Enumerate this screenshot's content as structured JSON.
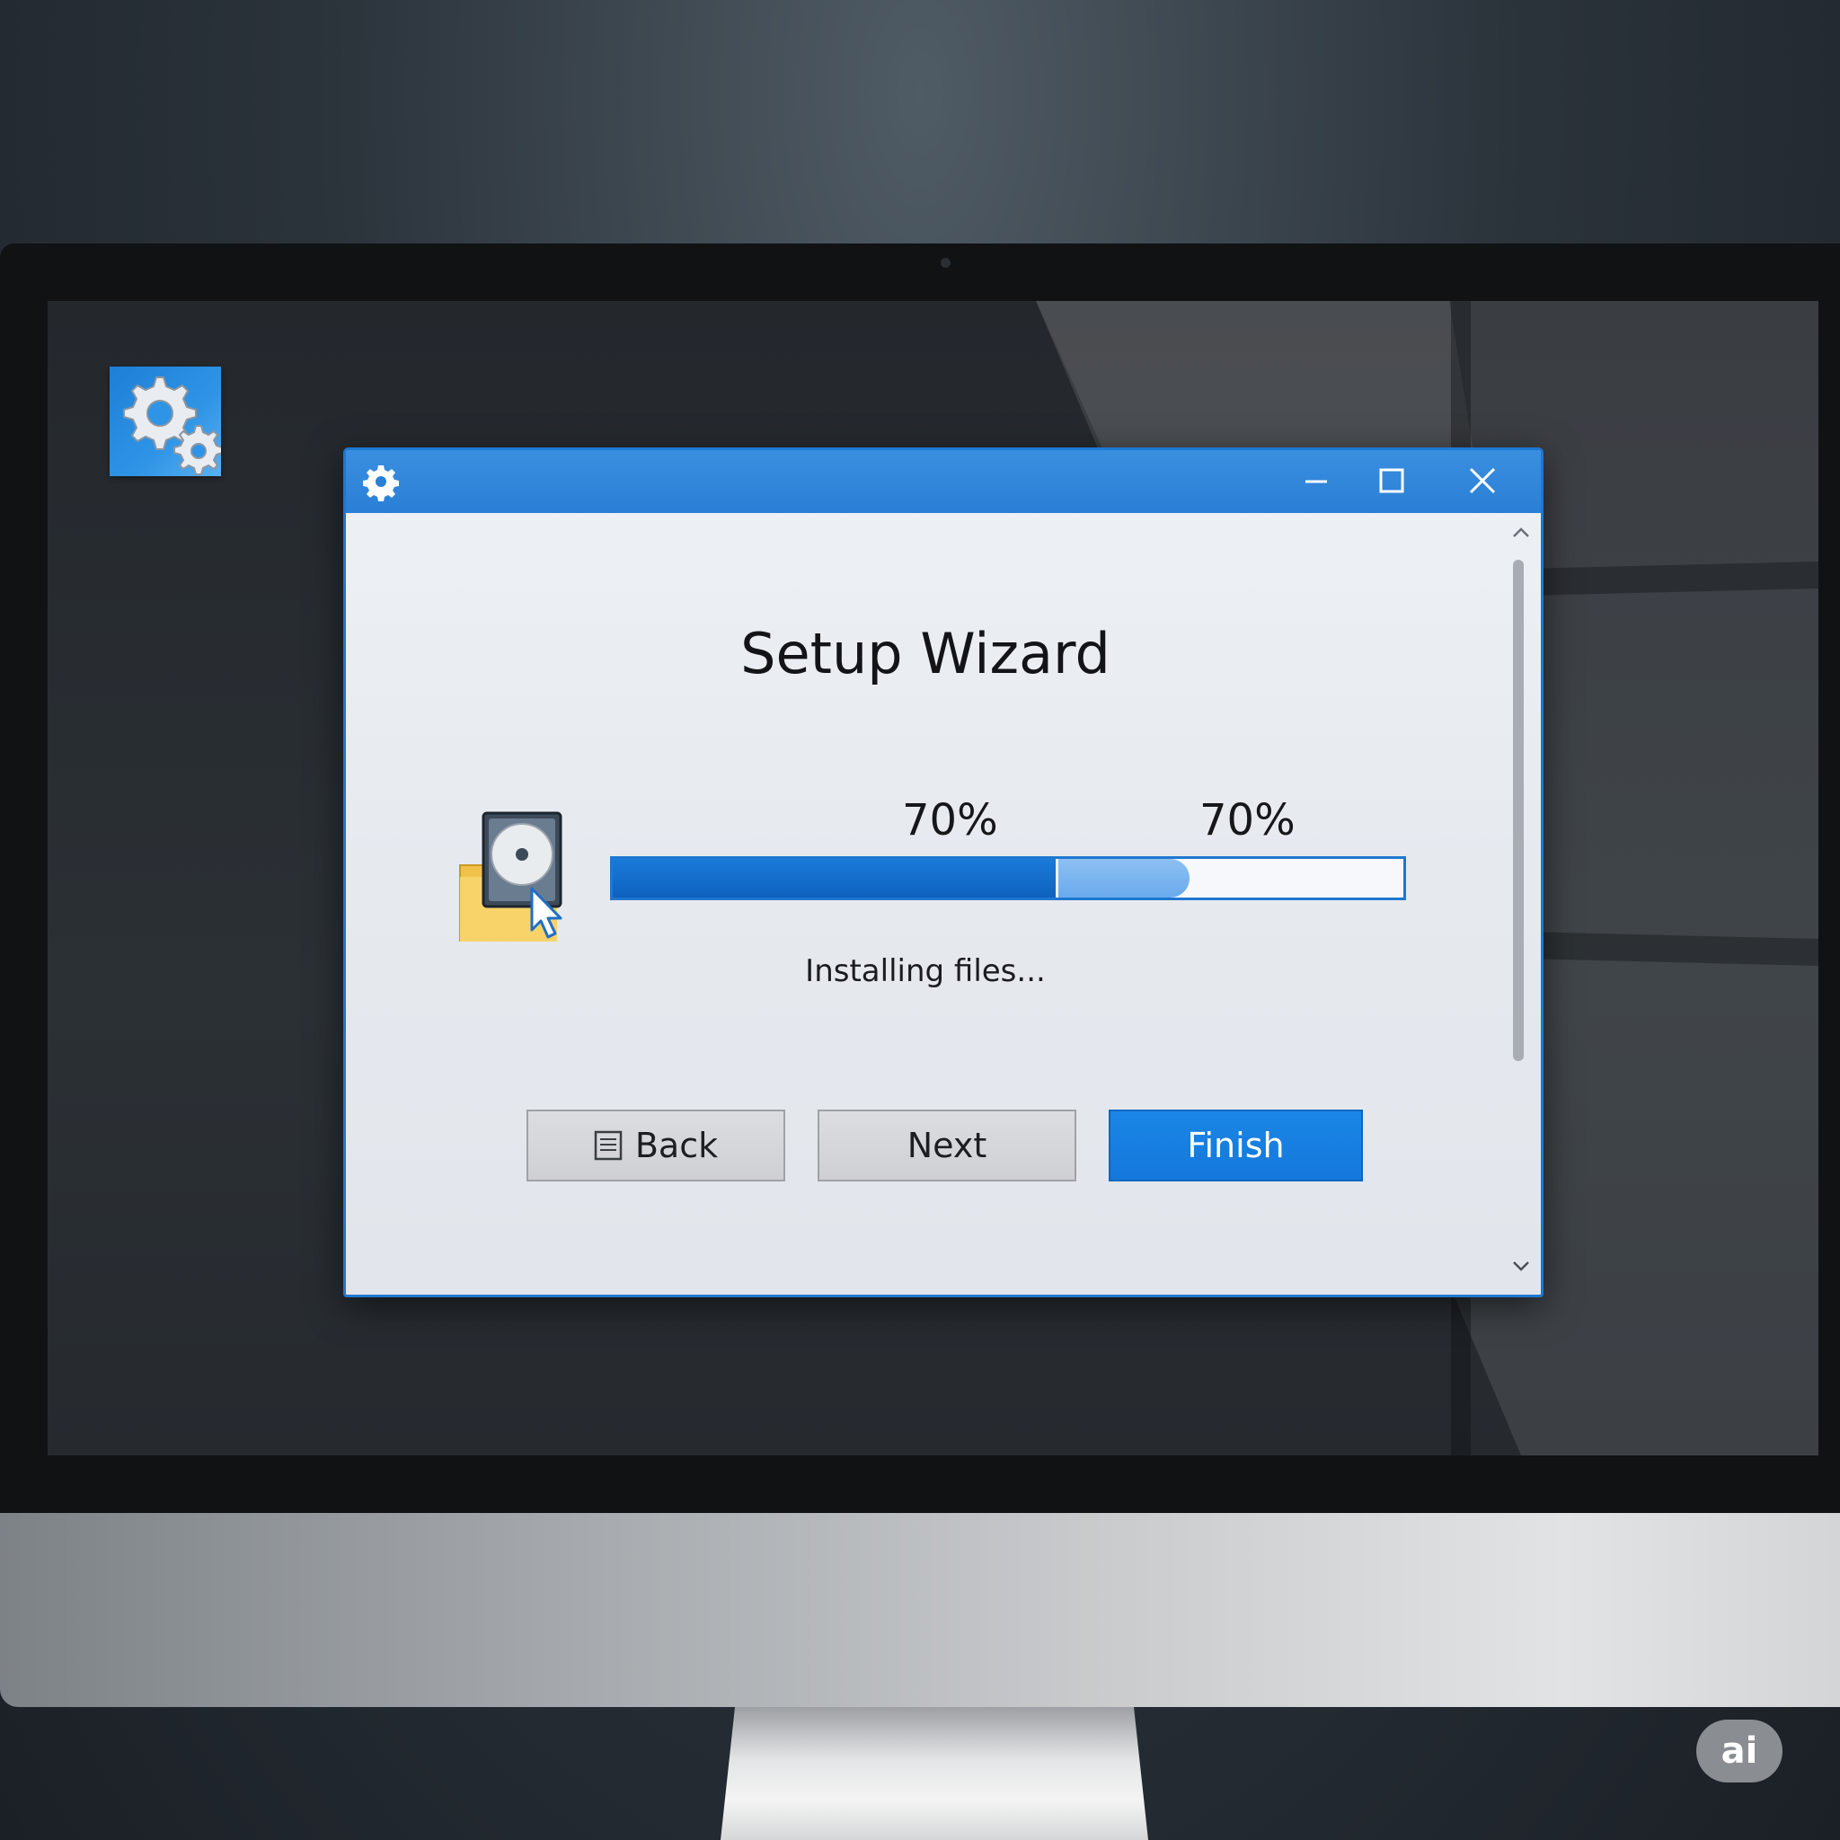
{
  "desktop": {
    "icon_name": "gear-settings-icon",
    "accent": "#1f77d0"
  },
  "window": {
    "title_icon": "gear-icon",
    "controls": {
      "minimize": "minimize-icon",
      "maximize": "maximize-icon",
      "close": "close-icon"
    },
    "heading": "Setup Wizard",
    "install_icon": "hard-drive-folder-icon",
    "progress": {
      "label_primary": "70%",
      "label_secondary": "70%",
      "value": 0.56,
      "secondary_value": 0.73,
      "status": "Installing files..."
    },
    "buttons": {
      "back_label": "Back",
      "back_icon": "document-icon",
      "next_label": "Next",
      "finish_label": "Finish"
    }
  },
  "badge": {
    "label": "ai"
  },
  "colors": {
    "titlebar": "#2a7fd6",
    "finish_button": "#1478db",
    "progress_fill": "#0e62be",
    "progress_secondary": "#6aaaec"
  }
}
